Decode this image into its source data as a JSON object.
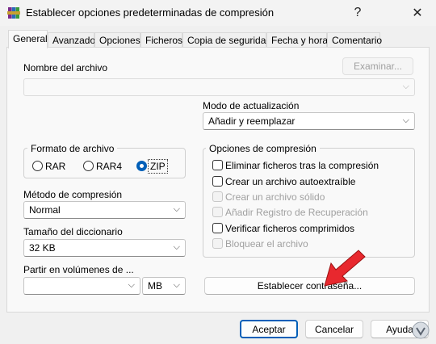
{
  "window": {
    "title": "Establecer opciones predeterminadas de compresión",
    "help_glyph": "?",
    "close_glyph": "✕"
  },
  "tabs": [
    {
      "label": "General"
    },
    {
      "label": "Avanzado"
    },
    {
      "label": "Opciones"
    },
    {
      "label": "Ficheros"
    },
    {
      "label": "Copia de seguridad"
    },
    {
      "label": "Fecha y hora"
    },
    {
      "label": "Comentario"
    }
  ],
  "archive_name": {
    "label": "Nombre del archivo",
    "value": "",
    "browse_label": "Examinar..."
  },
  "update_mode": {
    "label": "Modo de actualización",
    "value": "Añadir y reemplazar"
  },
  "archive_format": {
    "label": "Formato de archivo",
    "options": [
      {
        "label": "RAR"
      },
      {
        "label": "RAR4"
      },
      {
        "label": "ZIP"
      }
    ],
    "selected": "ZIP"
  },
  "compression_method": {
    "label": "Método de compresión",
    "value": "Normal"
  },
  "dictionary_size": {
    "label": "Tamaño del diccionario",
    "value": "32 KB"
  },
  "split_volumes": {
    "label": "Partir en volúmenes de ...",
    "value": "",
    "unit": "MB"
  },
  "compression_options": {
    "label": "Opciones de compresión",
    "items": [
      {
        "label": "Eliminar ficheros tras la compresión",
        "checked": false,
        "enabled": true
      },
      {
        "label": "Crear un archivo autoextraíble",
        "checked": false,
        "enabled": true
      },
      {
        "label": "Crear un archivo sólido",
        "checked": false,
        "enabled": false
      },
      {
        "label": "Añadir Registro de Recuperación",
        "checked": false,
        "enabled": false
      },
      {
        "label": "Verificar ficheros comprimidos",
        "checked": false,
        "enabled": true
      },
      {
        "label": "Bloquear el archivo",
        "checked": false,
        "enabled": false
      }
    ]
  },
  "set_password_label": "Establecer contraseña...",
  "footer": {
    "ok_label": "Aceptar",
    "cancel_label": "Cancelar",
    "help_label": "Ayuda"
  },
  "colors": {
    "accent": "#005fb8",
    "annotation_arrow": "#e8282e"
  }
}
